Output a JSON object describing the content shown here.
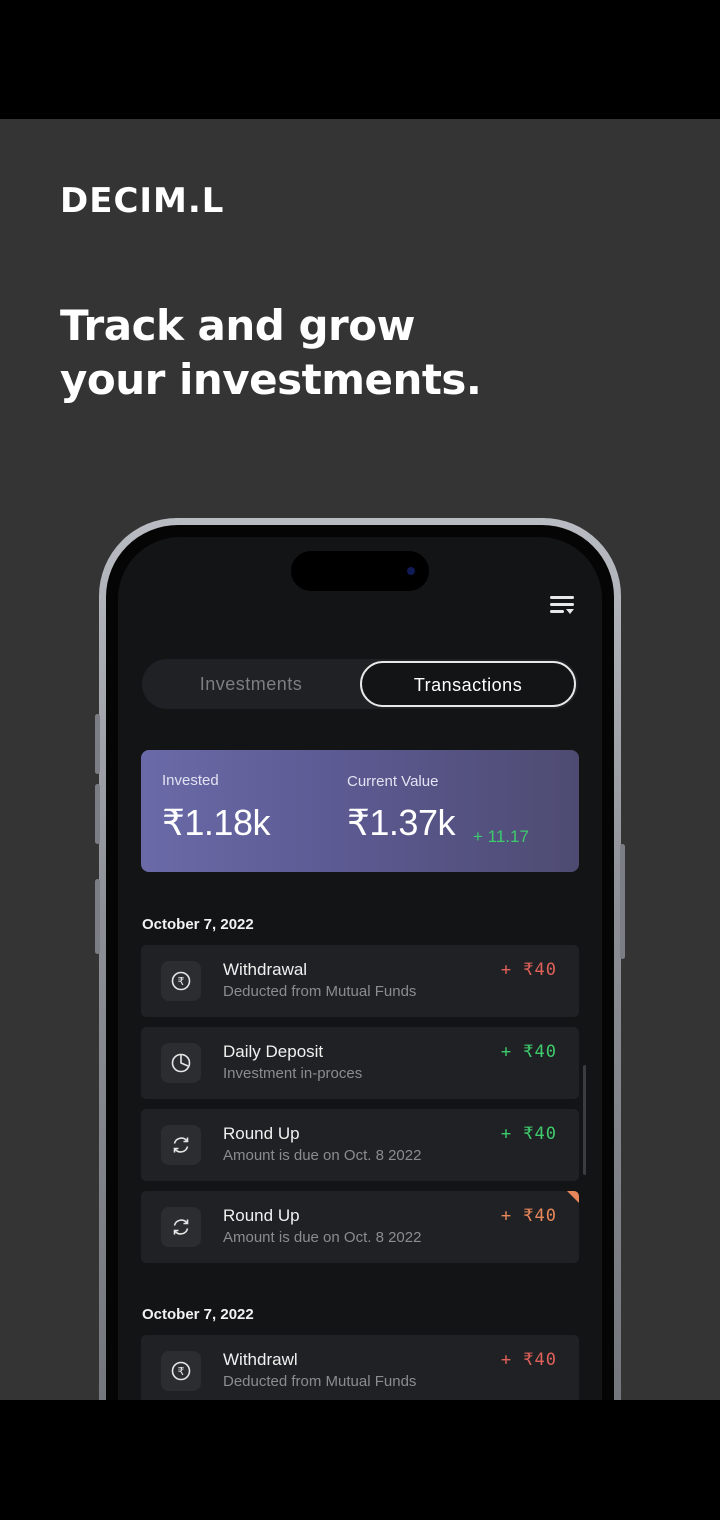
{
  "brand": "DECIM.L",
  "headline": {
    "line1": "Track and grow",
    "line2": "your investments."
  },
  "tabs": {
    "investments": "Investments",
    "transactions": "Transactions",
    "active": "Transactions"
  },
  "summary": {
    "invested_label": "Invested",
    "invested_value": "₹1.18k",
    "current_label": "Current Value",
    "current_value": "₹1.37k",
    "delta": "+ 11.17"
  },
  "groups": [
    {
      "date": "October 7, 2022",
      "items": [
        {
          "title": "Withdrawal",
          "subtitle": "Deducted from Mutual Funds",
          "amount": "+ ₹40",
          "icon": "rupee-circle-icon",
          "status_color": "#e0605a"
        },
        {
          "title": "Daily Deposit",
          "subtitle": "Investment in-proces",
          "amount": "+ ₹40",
          "icon": "pie-chart-icon",
          "status_color": "#3ecb6d"
        },
        {
          "title": "Round Up",
          "subtitle": "Amount is due on Oct. 8 2022",
          "amount": "+ ₹40",
          "icon": "sync-icon",
          "status_color": "#3ecb6d"
        },
        {
          "title": "Round Up",
          "subtitle": "Amount is due on Oct. 8 2022",
          "amount": "+ ₹40",
          "icon": "sync-icon",
          "status_color": "#e8875a"
        }
      ]
    },
    {
      "date": "October 7, 2022",
      "items": [
        {
          "title": "Withdrawl",
          "subtitle": "Deducted from Mutual Funds",
          "amount": "+ ₹40",
          "icon": "rupee-circle-icon",
          "status_color": "#e0605a"
        }
      ]
    }
  ],
  "colors": {
    "background": "#343434",
    "card_gradient": [
      "#6a6aa8",
      "#4e4b72"
    ],
    "positive": "#3ecb6d",
    "negative": "#e0605a",
    "pending": "#e8875a"
  }
}
